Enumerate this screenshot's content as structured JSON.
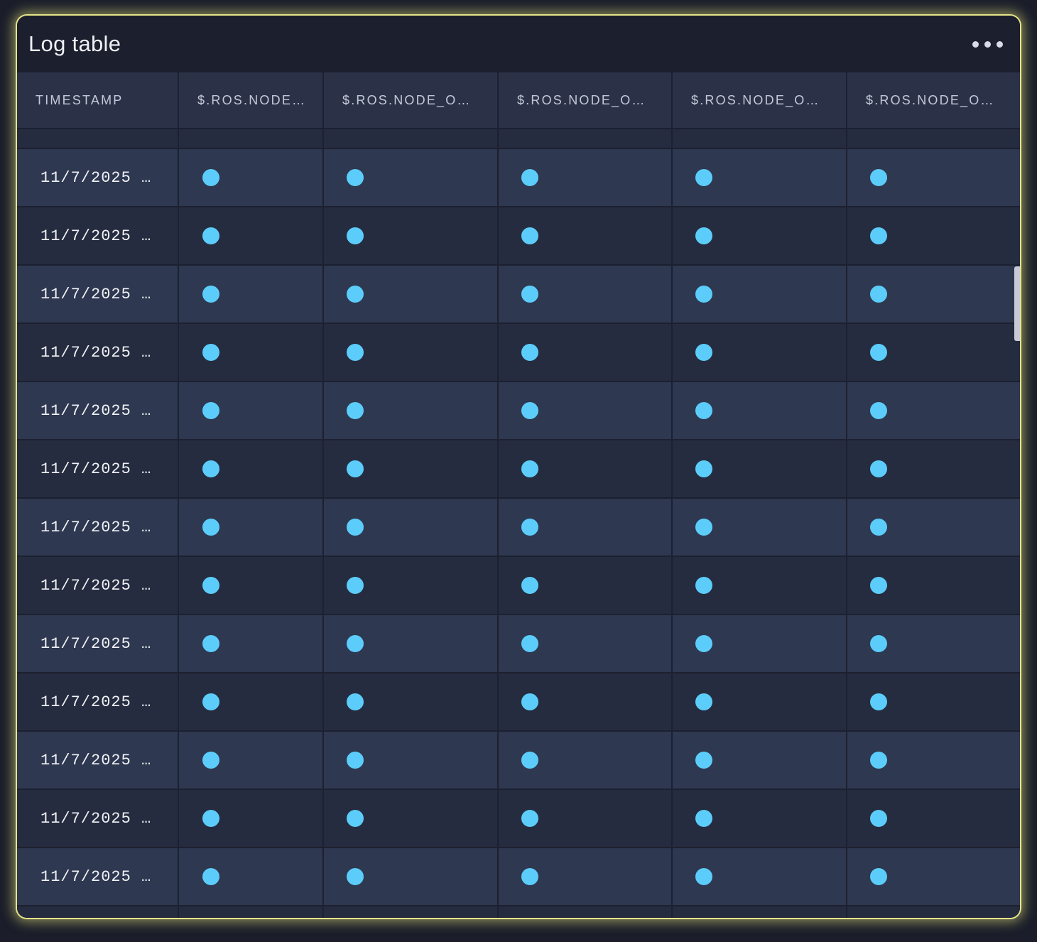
{
  "panel": {
    "title": "Log table",
    "menu_icon": "more-horizontal-icon"
  },
  "table": {
    "columns": [
      "TIMESTAMP",
      "$.ROS.NODE_O…",
      "$.ROS.NODE_O…",
      "$.ROS.NODE_O…",
      "$.ROS.NODE_O…",
      "$.ROS.NODE_O…"
    ],
    "rows": [
      {
        "timestamp": "11/7/2025 …"
      },
      {
        "timestamp": "11/7/2025 …"
      },
      {
        "timestamp": "11/7/2025 …"
      },
      {
        "timestamp": "11/7/2025 …"
      },
      {
        "timestamp": "11/7/2025 …"
      },
      {
        "timestamp": "11/7/2025 …"
      },
      {
        "timestamp": "11/7/2025 …"
      },
      {
        "timestamp": "11/7/2025 …"
      },
      {
        "timestamp": "11/7/2025 …"
      },
      {
        "timestamp": "11/7/2025 …"
      },
      {
        "timestamp": "11/7/2025 …"
      },
      {
        "timestamp": "11/7/2025 …"
      },
      {
        "timestamp": "11/7/2025 …"
      }
    ],
    "cell_indicator": "status-dot-icon"
  },
  "colors": {
    "accent_glow": "#e6e58a",
    "status_dot": "#5ccdfb",
    "row_odd": "#2e3850",
    "row_even": "#262c3f",
    "header": "#2b3248"
  }
}
